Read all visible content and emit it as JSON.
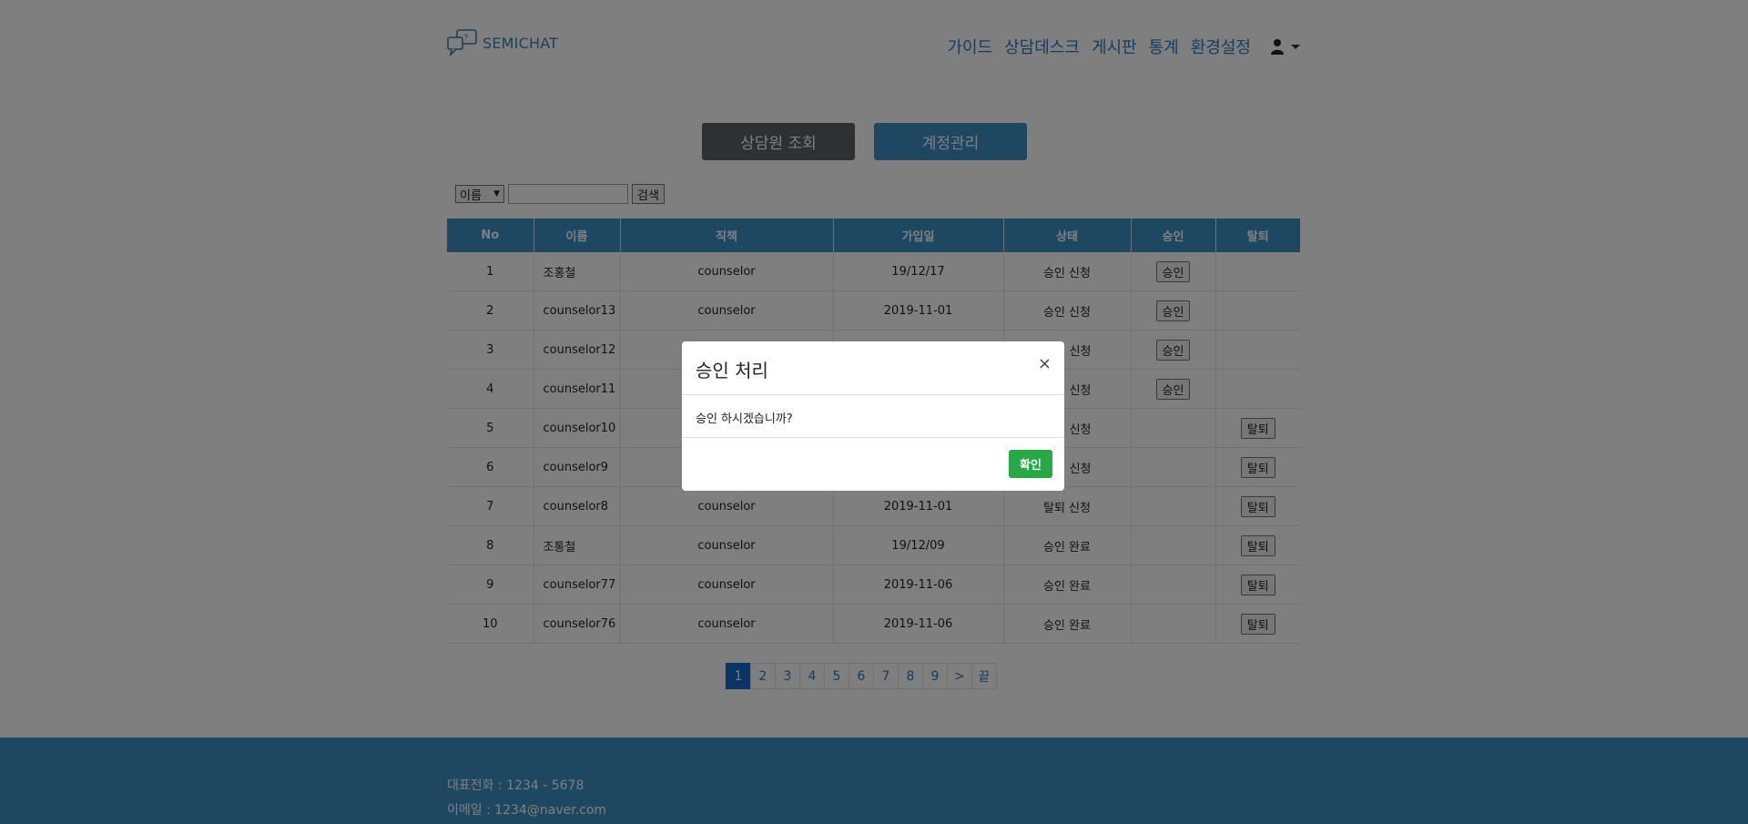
{
  "header": {
    "logo_text": "SEMICHAT",
    "nav": [
      "가이드",
      "상담데스크",
      "게시판",
      "통계",
      "환경설정"
    ]
  },
  "tabs": {
    "lookup": "상담원 조회",
    "account": "계정관리"
  },
  "search": {
    "select_value": "이름",
    "select_arrow": "▼",
    "input_value": "",
    "button": "검색"
  },
  "table": {
    "headers": [
      "No",
      "이름",
      "직책",
      "가입일",
      "상태",
      "승인",
      "탈퇴"
    ],
    "rows": [
      {
        "no": "1",
        "name": "조홍철",
        "role": "counselor",
        "date": "19/12/17",
        "status": "승인 신청",
        "approve": "승인",
        "withdraw": ""
      },
      {
        "no": "2",
        "name": "counselor13",
        "role": "counselor",
        "date": "2019-11-01",
        "status": "승인 신청",
        "approve": "승인",
        "withdraw": ""
      },
      {
        "no": "3",
        "name": "counselor12",
        "role": "",
        "date": "",
        "status": "신청",
        "approve": "승인",
        "withdraw": ""
      },
      {
        "no": "4",
        "name": "counselor11",
        "role": "",
        "date": "",
        "status": "신청",
        "approve": "승인",
        "withdraw": ""
      },
      {
        "no": "5",
        "name": "counselor10",
        "role": "",
        "date": "",
        "status": "신청",
        "approve": "",
        "withdraw": "탈퇴"
      },
      {
        "no": "6",
        "name": "counselor9",
        "role": "",
        "date": "",
        "status": "신청",
        "approve": "",
        "withdraw": "탈퇴"
      },
      {
        "no": "7",
        "name": "counselor8",
        "role": "counselor",
        "date": "2019-11-01",
        "status": "탈퇴 신청",
        "approve": "",
        "withdraw": "탈퇴"
      },
      {
        "no": "8",
        "name": "조통철",
        "role": "counselor",
        "date": "19/12/09",
        "status": "승인 완료",
        "approve": "",
        "withdraw": "탈퇴"
      },
      {
        "no": "9",
        "name": "counselor77",
        "role": "counselor",
        "date": "2019-11-06",
        "status": "승인 완료",
        "approve": "",
        "withdraw": "탈퇴"
      },
      {
        "no": "10",
        "name": "counselor76",
        "role": "counselor",
        "date": "2019-11-06",
        "status": "승인 완료",
        "approve": "",
        "withdraw": "탈퇴"
      }
    ]
  },
  "pagination": [
    "1",
    "2",
    "3",
    "4",
    "5",
    "6",
    "7",
    "8",
    "9",
    ">",
    "끝"
  ],
  "footer": {
    "phone": "대표전화 : 1234 - 5678",
    "email": "이메일 : 1234@naver.com"
  },
  "modal": {
    "title": "승인 처리",
    "close": "×",
    "message": "승인 하시겠습니까?",
    "confirm": "확인"
  },
  "colors": {
    "primary": "#3c8ec4",
    "confirm": "#28a745",
    "active_page": "#1268c9",
    "tab_dark": "#5a6268"
  }
}
